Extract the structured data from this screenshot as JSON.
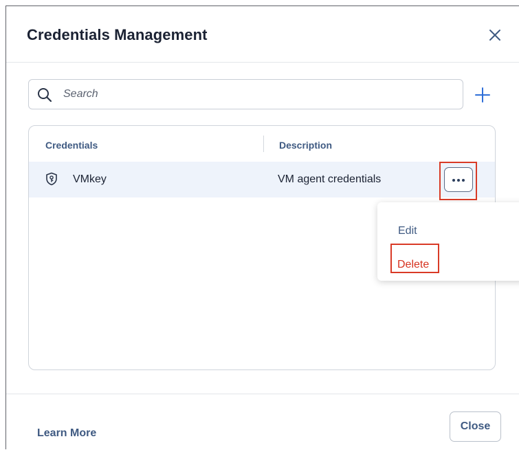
{
  "dialog": {
    "title": "Credentials Management"
  },
  "search": {
    "placeholder": "Search",
    "value": ""
  },
  "table": {
    "columns": [
      "Credentials",
      "Description"
    ],
    "rows": [
      {
        "name": "VMkey",
        "description": "VM agent credentials",
        "icon": "shield-key-icon"
      }
    ]
  },
  "menu": {
    "items": [
      "Edit",
      "Delete"
    ]
  },
  "footer": {
    "learn_more": "Learn More",
    "close_label": "Close"
  },
  "colors": {
    "accent": "#3f5a82",
    "primary_icon": "#2f6fd8",
    "danger": "#d6321f",
    "highlight_border": "#d93a26",
    "row_selected": "#eef3fb"
  }
}
